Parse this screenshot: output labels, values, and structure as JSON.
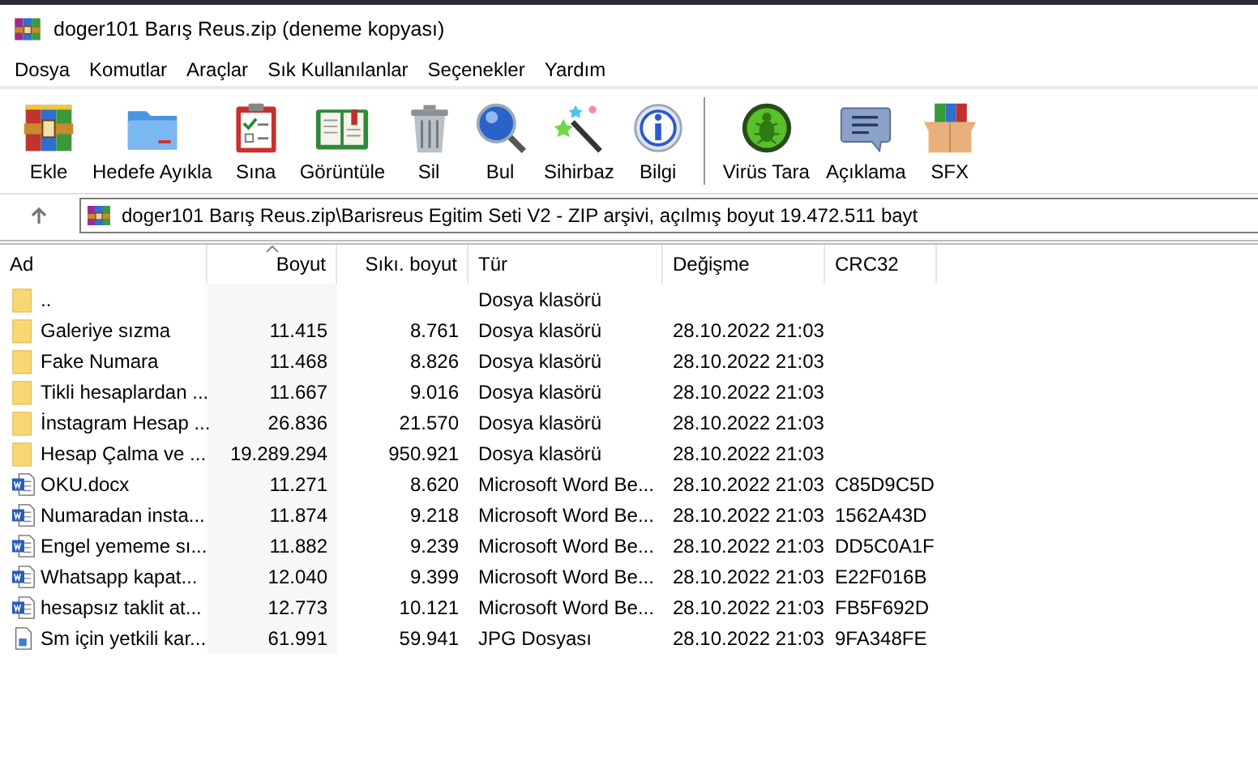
{
  "window": {
    "title": "doger101 Barış Reus.zip (deneme kopyası)"
  },
  "menu": [
    "Dosya",
    "Komutlar",
    "Araçlar",
    "Sık Kullanılanlar",
    "Seçenekler",
    "Yardım"
  ],
  "toolbar": {
    "groups": [
      [
        "Ekle",
        "Hedefe Ayıkla",
        "Sına",
        "Görüntüle",
        "Sil",
        "Bul",
        "Sihirbaz",
        "Bilgi"
      ],
      [
        "Virüs Tara",
        "Açıklama",
        "SFX"
      ]
    ]
  },
  "address": {
    "value": "doger101 Barış Reus.zip\\Barisreus Egitim Seti V2 - ZIP arşivi, açılmış boyut 19.472.511 bayt"
  },
  "table": {
    "columns": [
      {
        "label": "Ad",
        "sorted": false
      },
      {
        "label": "Boyut",
        "sorted": true
      },
      {
        "label": "Sıkı. boyut",
        "sorted": false
      },
      {
        "label": "Tür",
        "sorted": false
      },
      {
        "label": "Değişme",
        "sorted": false
      },
      {
        "label": "CRC32",
        "sorted": false
      }
    ],
    "rows": [
      {
        "kind": "folder",
        "cells": [
          "..",
          "",
          "",
          "Dosya klasörü",
          "",
          ""
        ]
      },
      {
        "kind": "folder",
        "cells": [
          "Galeriye sızma",
          "11.415",
          "8.761",
          "Dosya klasörü",
          "28.10.2022 21:03",
          ""
        ]
      },
      {
        "kind": "folder",
        "cells": [
          "Fake Numara",
          "11.468",
          "8.826",
          "Dosya klasörü",
          "28.10.2022 21:03",
          ""
        ]
      },
      {
        "kind": "folder",
        "cells": [
          "Tikli hesaplardan ...",
          "11.667",
          "9.016",
          "Dosya klasörü",
          "28.10.2022 21:03",
          ""
        ]
      },
      {
        "kind": "folder",
        "cells": [
          "İnstagram Hesap ...",
          "26.836",
          "21.570",
          "Dosya klasörü",
          "28.10.2022 21:03",
          ""
        ]
      },
      {
        "kind": "folder",
        "cells": [
          "Hesap Çalma ve ...",
          "19.289.294",
          "950.921",
          "Dosya klasörü",
          "28.10.2022 21:03",
          ""
        ]
      },
      {
        "kind": "word",
        "cells": [
          "OKU.docx",
          "11.271",
          "8.620",
          "Microsoft Word Be...",
          "28.10.2022 21:03",
          "C85D9C5D"
        ]
      },
      {
        "kind": "word",
        "cells": [
          "Numaradan insta...",
          "11.874",
          "9.218",
          "Microsoft Word Be...",
          "28.10.2022 21:03",
          "1562A43D"
        ]
      },
      {
        "kind": "word",
        "cells": [
          "Engel yememe sı...",
          "11.882",
          "9.239",
          "Microsoft Word Be...",
          "28.10.2022 21:03",
          "DD5C0A1F"
        ]
      },
      {
        "kind": "word",
        "cells": [
          "Whatsapp kapat...",
          "12.040",
          "9.399",
          "Microsoft Word Be...",
          "28.10.2022 21:03",
          "E22F016B"
        ]
      },
      {
        "kind": "word",
        "cells": [
          "hesapsız taklit at...",
          "12.773",
          "10.121",
          "Microsoft Word Be...",
          "28.10.2022 21:03",
          "FB5F692D"
        ]
      },
      {
        "kind": "image",
        "cells": [
          "Sm için yetkili kar...",
          "61.991",
          "59.941",
          "JPG Dosyası",
          "28.10.2022 21:03",
          "9FA348FE"
        ]
      }
    ]
  }
}
